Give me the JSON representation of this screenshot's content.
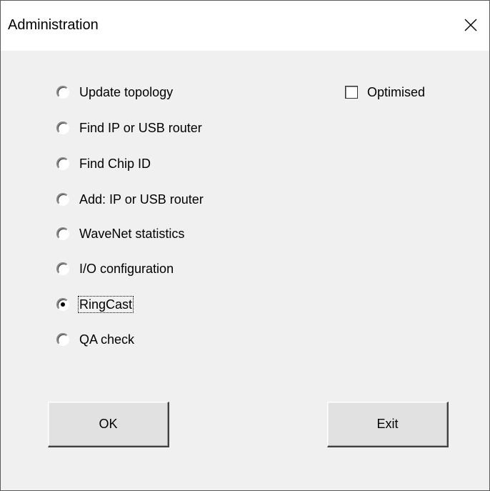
{
  "window": {
    "title": "Administration"
  },
  "options": [
    {
      "label": "Update topology",
      "checked": false
    },
    {
      "label": "Find IP or USB router",
      "checked": false
    },
    {
      "label": "Find Chip ID",
      "checked": false
    },
    {
      "label": "Add: IP or USB router",
      "checked": false
    },
    {
      "label": "WaveNet statistics",
      "checked": false
    },
    {
      "label": "I/O configuration",
      "checked": false
    },
    {
      "label": "RingCast",
      "checked": true
    },
    {
      "label": "QA check",
      "checked": false
    }
  ],
  "optimised": {
    "label": "Optimised",
    "checked": false
  },
  "buttons": {
    "ok_label": "OK",
    "exit_label": "Exit"
  }
}
